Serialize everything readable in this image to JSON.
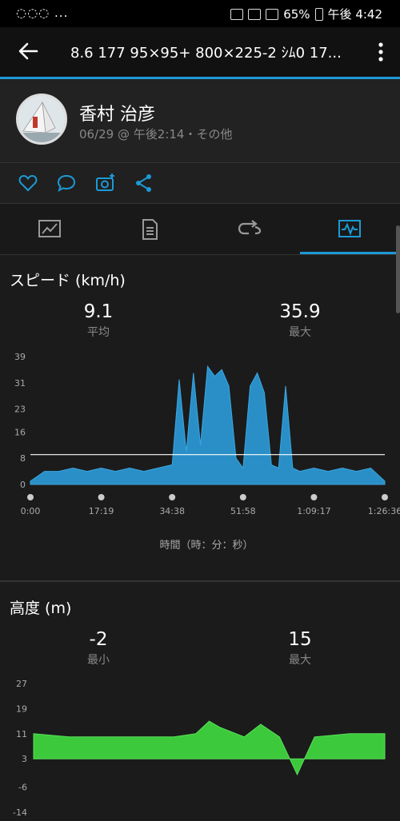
{
  "status_bar": {
    "left": "◌◌◌ ...",
    "battery": "65%",
    "time": "午後 4:42"
  },
  "app_bar": {
    "title": "8.6 177  95×95+    800×225-2  ｼﾑ0  17..."
  },
  "profile": {
    "name": "香村 治彦",
    "subtitle": "06/29 @ 午後2:14・その他"
  },
  "actions": [
    "like-icon",
    "comment-icon",
    "add-photo-icon",
    "share-icon"
  ],
  "tabs": [
    "summary-icon",
    "details-icon",
    "laps-icon",
    "charts-icon"
  ],
  "speed": {
    "title": "スピード (km/h)",
    "avg_value": "9.1",
    "avg_label": "平均",
    "max_value": "35.9",
    "max_label": "最大",
    "y_ticks": [
      "39",
      "31",
      "23",
      "16",
      "8",
      "0"
    ],
    "x_ticks": [
      "0:00",
      "17:19",
      "34:38",
      "51:58",
      "1:09:17",
      "1:26:36"
    ],
    "xlabel": "時間（時：分：秒）",
    "color": "#2a8fc7"
  },
  "elevation": {
    "title": "高度 (m)",
    "min_value": "-2",
    "min_label": "最小",
    "max_value": "15",
    "max_label": "最大",
    "y_ticks": [
      "27",
      "19",
      "11",
      "3",
      "-6",
      "-14"
    ],
    "color": "#3cc93c"
  },
  "chart_data": [
    {
      "type": "area",
      "title": "スピード (km/h)",
      "xlabel": "時間（時：分：秒）",
      "ylabel": "",
      "ylim": [
        0,
        39
      ],
      "x": [
        "0:00",
        "3:28",
        "6:56",
        "10:24",
        "13:52",
        "17:19",
        "20:47",
        "24:15",
        "27:43",
        "31:10",
        "34:38",
        "36:22",
        "38:06",
        "39:50",
        "41:34",
        "43:18",
        "45:02",
        "46:46",
        "48:30",
        "50:14",
        "51:58",
        "53:42",
        "55:26",
        "57:10",
        "58:54",
        "60:38",
        "62:22",
        "64:06",
        "65:50",
        "69:17",
        "72:45",
        "76:13",
        "79:41",
        "83:09",
        "86:36"
      ],
      "series": [
        {
          "values": [
            1,
            4,
            4,
            5,
            4,
            5,
            4,
            5,
            4,
            5,
            6,
            32,
            10,
            34,
            12,
            36,
            33,
            35,
            30,
            8,
            5,
            30,
            34,
            28,
            6,
            5,
            30,
            5,
            4,
            5,
            4,
            5,
            4,
            5,
            1
          ]
        }
      ],
      "reference_line": 9.1,
      "grid": false
    },
    {
      "type": "area",
      "title": "高度 (m)",
      "xlabel": "",
      "ylabel": "",
      "ylim": [
        -14,
        27
      ],
      "x": [
        "0:00",
        "8:40",
        "17:19",
        "26:00",
        "34:38",
        "40:00",
        "43:18",
        "46:00",
        "51:58",
        "56:00",
        "60:38",
        "65:00",
        "69:17",
        "78:00",
        "86:36"
      ],
      "series": [
        {
          "values": [
            11,
            10,
            10,
            10,
            10,
            11,
            15,
            13,
            10,
            14,
            10,
            -2,
            10,
            11,
            11
          ]
        }
      ],
      "grid": false
    }
  ]
}
